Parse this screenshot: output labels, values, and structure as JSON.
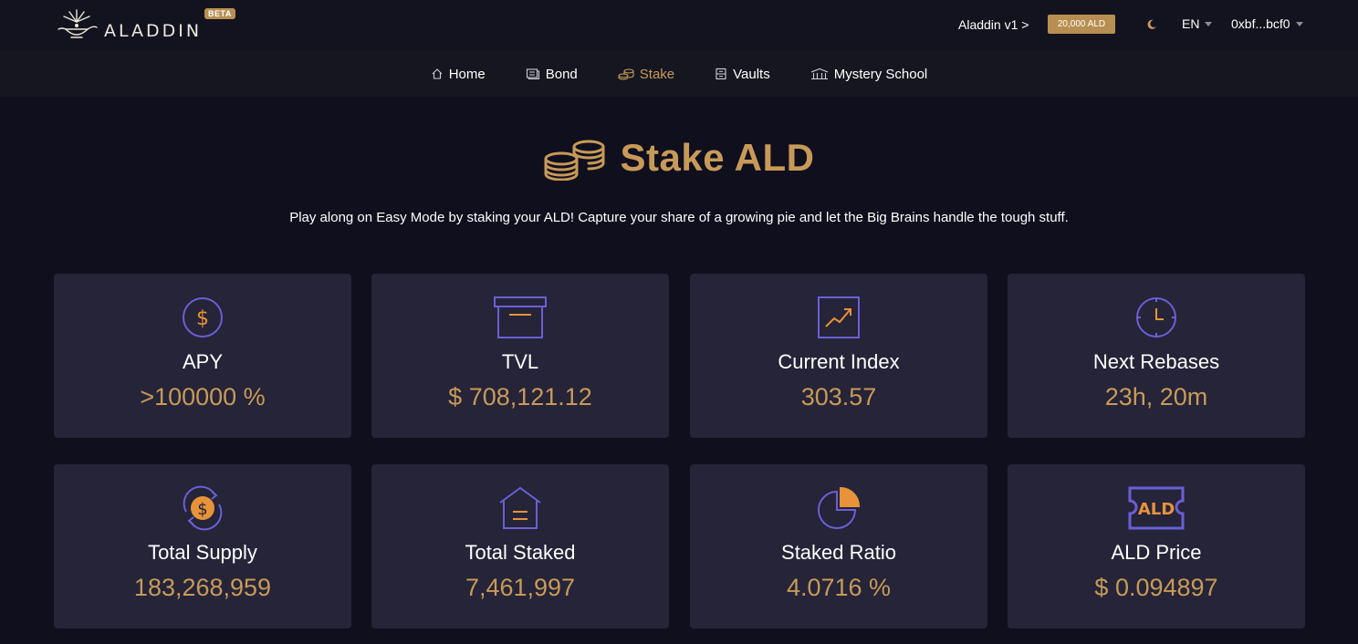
{
  "header": {
    "logo_text": "ALADDIN",
    "beta_label": "BETA",
    "version_link": "Aladdin v1 >",
    "balance_badge": "20,000 ALD",
    "language": "EN",
    "wallet_address": "0xbf...bcf0"
  },
  "nav": {
    "items": [
      {
        "label": "Home",
        "icon": "home-icon",
        "active": false
      },
      {
        "label": "Bond",
        "icon": "bond-icon",
        "active": false
      },
      {
        "label": "Stake",
        "icon": "stake-icon",
        "active": true
      },
      {
        "label": "Vaults",
        "icon": "vault-icon",
        "active": false
      },
      {
        "label": "Mystery School",
        "icon": "school-icon",
        "active": false
      }
    ]
  },
  "page": {
    "title": "Stake ALD",
    "subtitle": "Play along on Easy Mode by staking your ALD! Capture your share of a growing pie and let the Big Brains handle the tough stuff."
  },
  "stats": [
    {
      "label": "APY",
      "value": ">100000 %",
      "icon": "dollar-circle-icon"
    },
    {
      "label": "TVL",
      "value": "$ 708,121.12",
      "icon": "archive-box-icon"
    },
    {
      "label": "Current Index",
      "value": "303.57",
      "icon": "trend-chart-icon"
    },
    {
      "label": "Next Rebases",
      "value": "23h, 20m",
      "icon": "clock-icon"
    },
    {
      "label": "Total Supply",
      "value": "183,268,959",
      "icon": "supply-coin-icon"
    },
    {
      "label": "Total Staked",
      "value": "7,461,997",
      "icon": "staked-house-icon"
    },
    {
      "label": "Staked Ratio",
      "value": "4.0716 %",
      "icon": "pie-chart-icon"
    },
    {
      "label": "ALD Price",
      "value": "$ 0.094897",
      "icon": "ald-ticket-icon"
    }
  ],
  "colors": {
    "background": "#0f0f1e",
    "card": "#252438",
    "accent_gold": "#c89a58",
    "accent_purple": "#6b5fd6",
    "accent_orange": "#e8933a"
  }
}
